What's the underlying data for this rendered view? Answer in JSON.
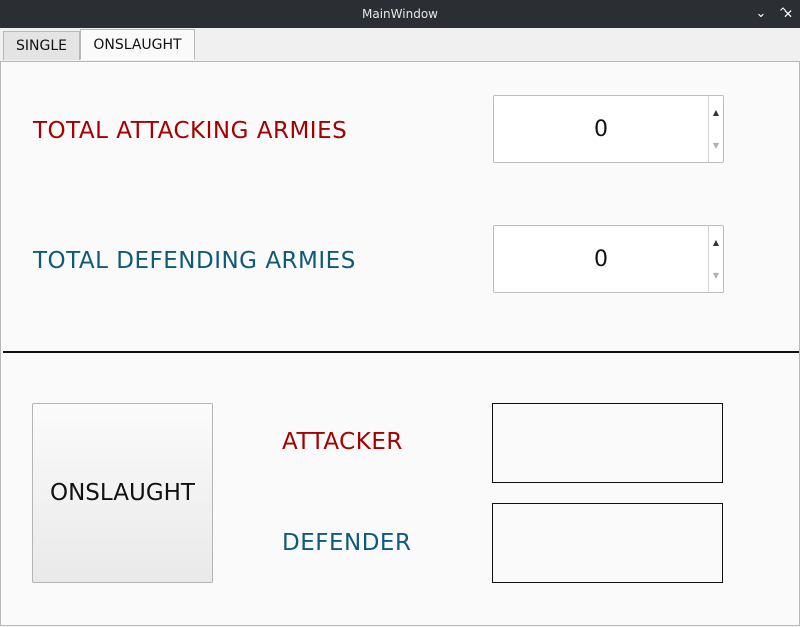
{
  "window": {
    "title": "MainWindow",
    "minimize_glyph": "⌄",
    "maximize_glyph": "⌃",
    "close_glyph": "✕"
  },
  "tabs": [
    {
      "label": "SINGLE",
      "active": false
    },
    {
      "label": "ONSLAUGHT",
      "active": true
    }
  ],
  "onslaught": {
    "attacking_label": "TOTAL ATTACKING ARMIES",
    "attacking_value": "0",
    "defending_label": "TOTAL DEFENDING ARMIES",
    "defending_value": "0",
    "button_label": "ONSLAUGHT",
    "attacker_label": "ATTACKER",
    "attacker_result": "",
    "defender_label": "DEFENDER",
    "defender_result": ""
  },
  "colors": {
    "attacker": "#a50000",
    "defender": "#0f5a78"
  },
  "icons": {
    "spin_up": "▲",
    "spin_down": "▼"
  }
}
